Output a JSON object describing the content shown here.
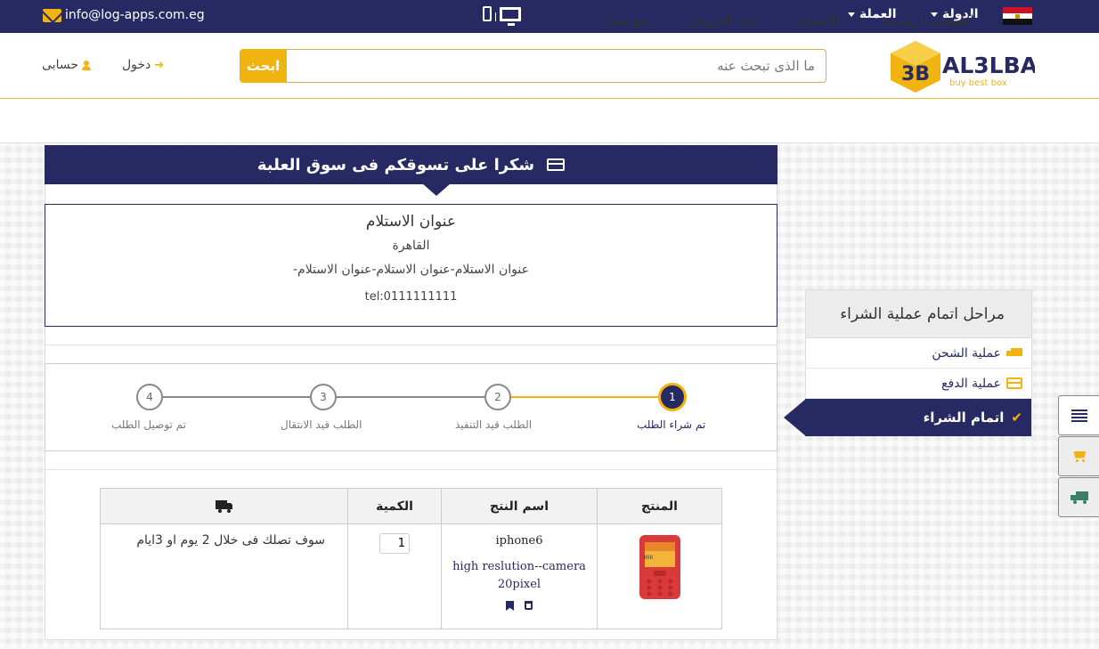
{
  "topbar": {
    "email": "info@log-apps.com.eg",
    "country_label": "الدولة",
    "currency_label": "العملة"
  },
  "header": {
    "logo_text": "AL3LBA",
    "logo_tagline": "buy best box",
    "logo_mark": "3B",
    "search_placeholder": "ما الذى تبحث عنه",
    "search_button": "ابحث",
    "login_label": "دخول",
    "account_label": "حسابى"
  },
  "nav": {
    "items": [
      "الصفحة الرئيسية",
      "الاقسام",
      "اجدد العروض",
      "بيع معنا"
    ]
  },
  "panel": {
    "title": "شكرا على تسوقكم فى سوق العلبة"
  },
  "address": {
    "title": "عنوان الاستلام",
    "city": "القاهرة",
    "line": "عنوان الاستلام-عنوان الاستلام-عنوان الاستلام-",
    "tel": "tel:0111111111"
  },
  "steps": [
    {
      "number": "1",
      "label": "تم شراء الطلب",
      "active": true
    },
    {
      "number": "2",
      "label": "الطلب قيد التنفيذ",
      "active": false
    },
    {
      "number": "3",
      "label": "الطلب قيد الانتقال",
      "active": false
    },
    {
      "number": "4",
      "label": "تم توصيل الطلب",
      "active": false
    }
  ],
  "cart": {
    "headers": {
      "product": "المنتج",
      "name": "اسم النتج",
      "quantity": "الكمية",
      "delivery_icon": "truck-icon"
    },
    "row": {
      "name": "iphone6",
      "description": "high reslution--camera 20pixel",
      "quantity": "1",
      "delivery_text": "سوف تصلك فى خلال 2 يوم او 3ايام"
    }
  },
  "sidebar": {
    "title": "مراحل اتمام عملية الشراء",
    "items": [
      "عملية الشحن",
      "عملية الدفع"
    ],
    "active_item": "اتمام الشراء"
  },
  "colors": {
    "navy": "#272a62",
    "gold": "#f0b30f"
  }
}
